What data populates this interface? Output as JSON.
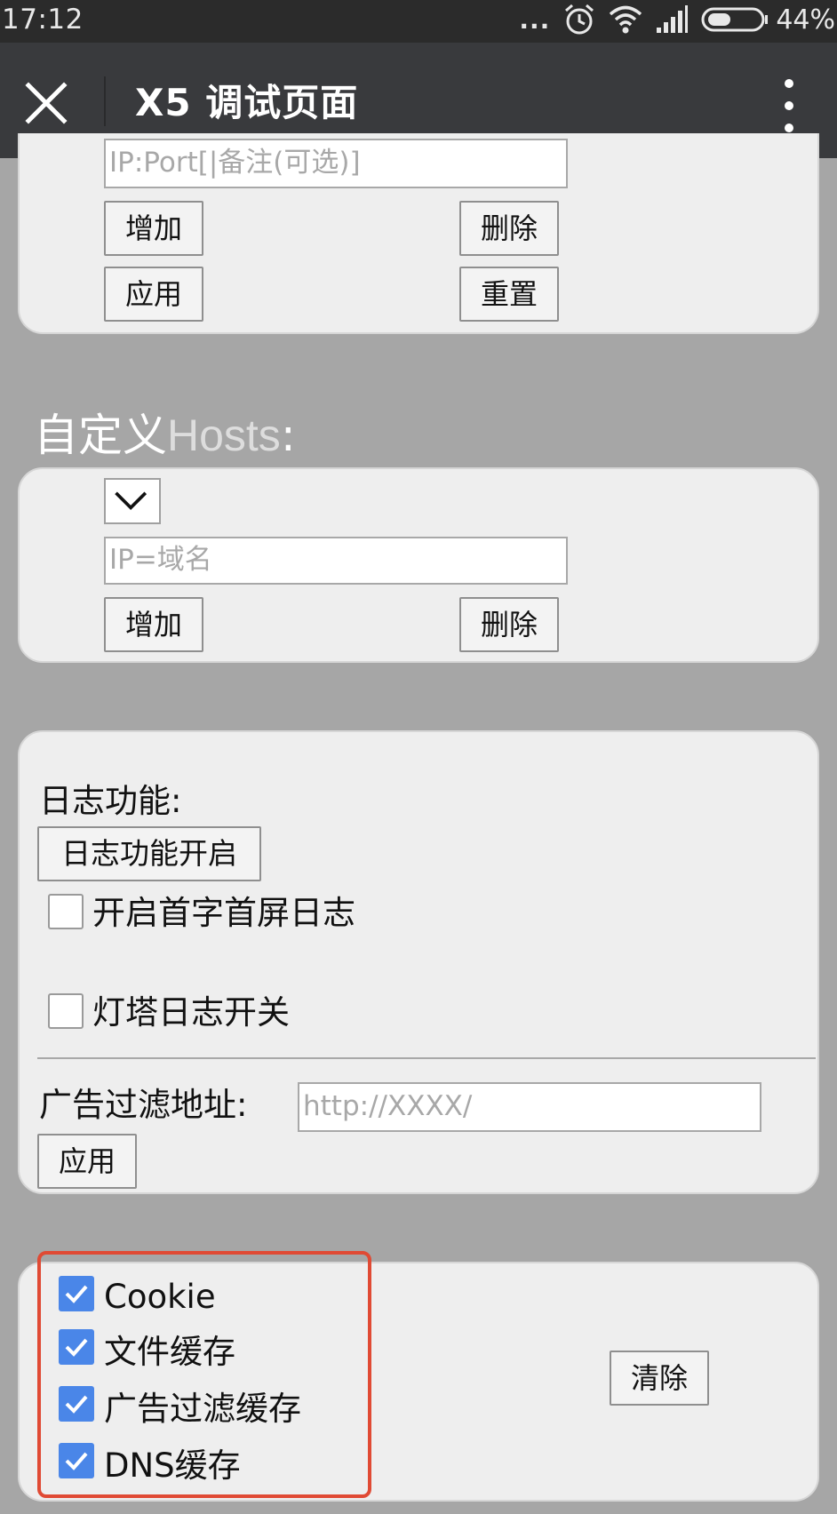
{
  "status_bar": {
    "time": "17:12",
    "dots": "...",
    "battery_percent": "44%",
    "battery_level": 0.44,
    "icons": [
      "alarm-icon",
      "wifi-icon",
      "signal-icon",
      "battery-icon"
    ]
  },
  "title_bar": {
    "title": "X5 调试页面",
    "close_icon": "close-icon",
    "more_icon": "more-vertical-icon"
  },
  "proxy_section": {
    "input_placeholder": "IP:Port[|备注(可选)]",
    "add_label": "增加",
    "delete_label": "删除",
    "apply_label": "应用",
    "reset_label": "重置"
  },
  "hosts_section": {
    "heading_cn": "自定义",
    "heading_en": "Hosts",
    "heading_colon": ":",
    "select_icon": "chevron-down-icon",
    "input_placeholder": "IP=域名",
    "add_label": "增加",
    "delete_label": "删除"
  },
  "log_section": {
    "log_label": "日志功能:",
    "log_button": "日志功能开启",
    "first_screen_log_label": "开启首字首屏日志",
    "first_screen_log_checked": false,
    "beacon_log_label": "灯塔日志开关",
    "beacon_log_checked": false,
    "ad_filter_label": "广告过滤地址:",
    "ad_filter_placeholder": "http://XXXX/",
    "apply_label": "应用"
  },
  "cache_section": {
    "items": [
      {
        "label": "Cookie",
        "checked": true
      },
      {
        "label": "文件缓存",
        "checked": true
      },
      {
        "label": "广告过滤缓存",
        "checked": true
      },
      {
        "label": "DNS缓存",
        "checked": true
      }
    ],
    "clear_label": "清除",
    "highlight_color": "#e04a34"
  },
  "colors": {
    "title_bar_bg": "#393a3d",
    "status_bar_bg": "#2b2b2b",
    "page_bg": "#a6a6a6",
    "panel_bg": "#eeeeee",
    "checkbox_checked": "#4a86e8"
  }
}
